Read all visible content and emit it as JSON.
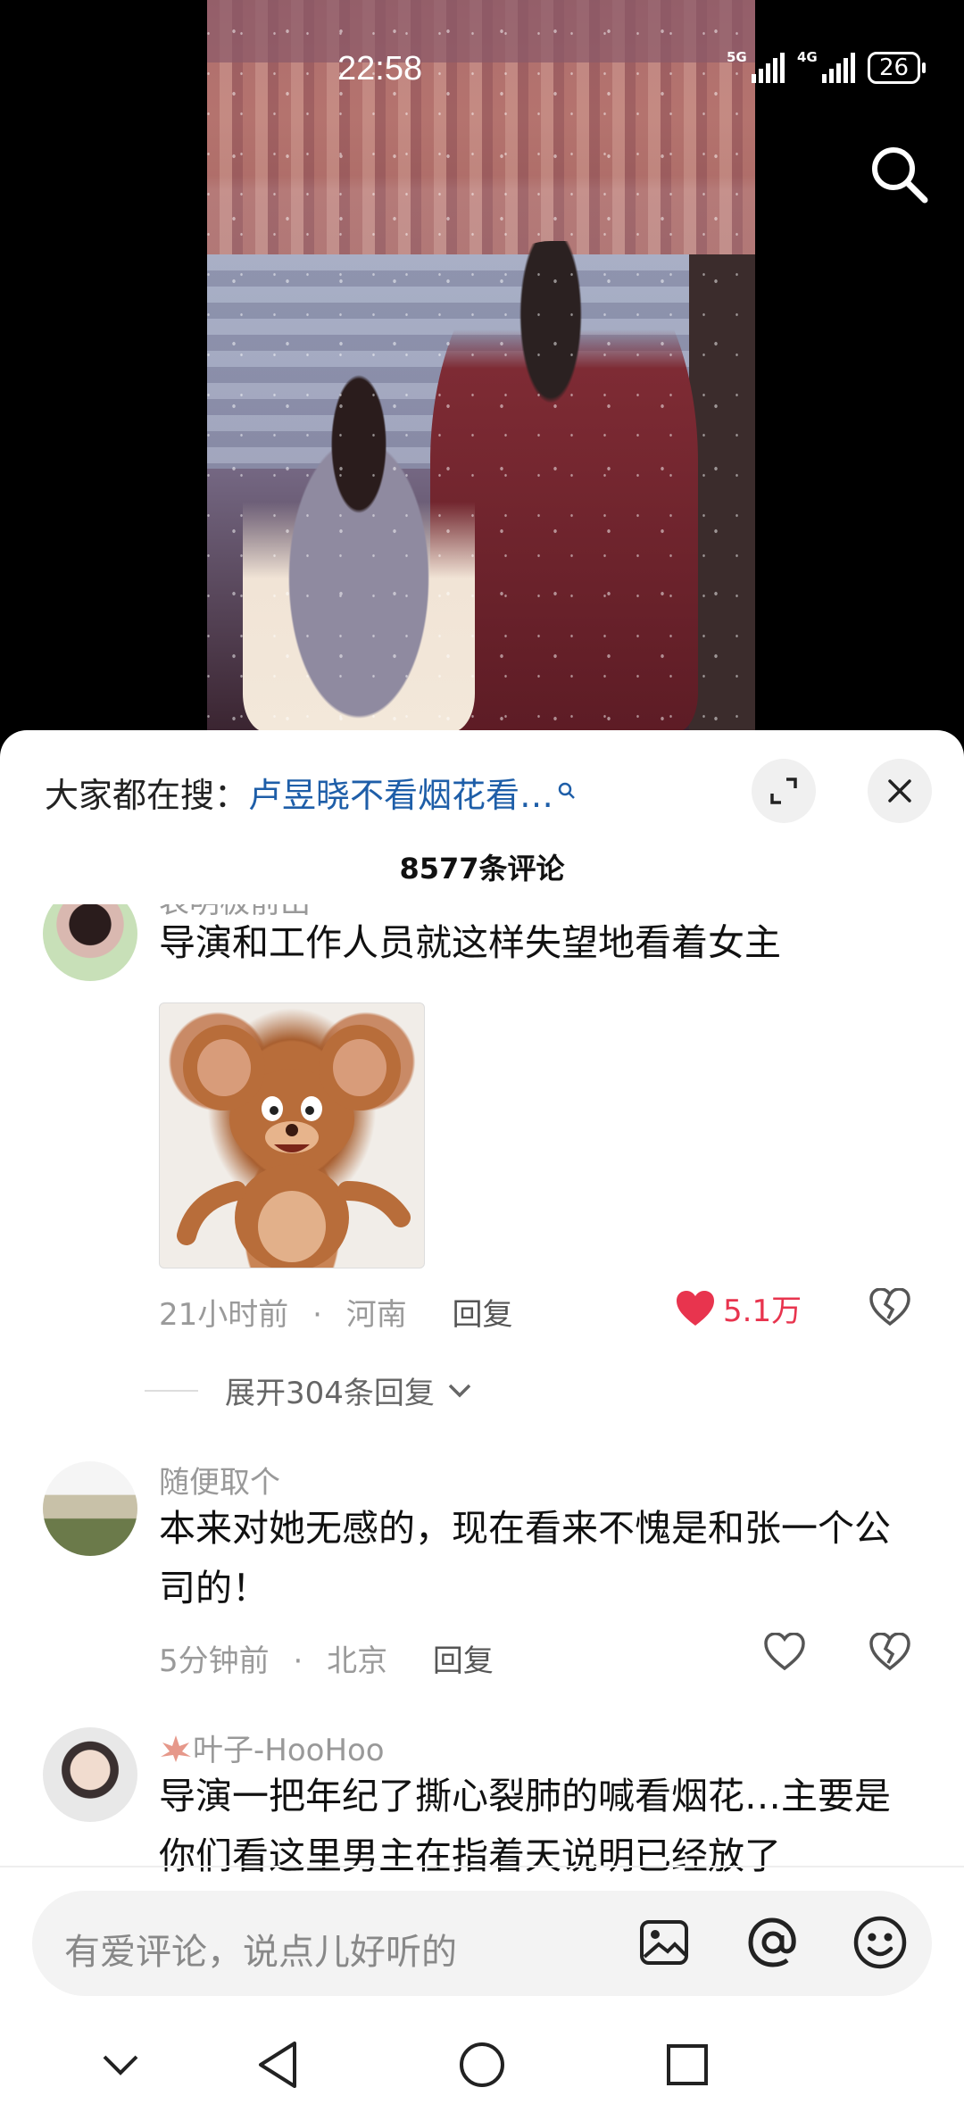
{
  "status_bar": {
    "time": "22:58",
    "signal1_label": "5G",
    "signal2_label": "4G",
    "battery": "26"
  },
  "video": {
    "search_icon": "search-icon"
  },
  "sheet": {
    "trending_prefix": "大家都在搜：",
    "trending_keyword": "卢昱晓不看烟花看…",
    "comment_count": "8577条评论",
    "expand_icon": "expand-icon",
    "close_icon": "close-icon"
  },
  "comments": [
    {
      "user": "表明极前出",
      "text": "导演和工作人员就这样失望地看着女主",
      "has_sticker": true,
      "time": "21小时前",
      "location": "河南",
      "reply_label": "回复",
      "likes": "5.1万",
      "liked": true,
      "expand_replies": "展开304条回复"
    },
    {
      "user": "随便取个",
      "text": "本来对她无感的，现在看来不愧是和张一个公司的！",
      "time": "5分钟前",
      "location": "北京",
      "reply_label": "回复",
      "liked": false
    },
    {
      "user": "叶子-HooHoo",
      "text": "导演一把年纪了撕心裂肺的喊看烟花…主要是你们看这里男主在指着天说明已经放了",
      "liked": false
    }
  ],
  "input_bar": {
    "placeholder": "有爱评论，说点儿好听的",
    "icons": [
      "image-icon",
      "at-icon",
      "emoji-icon"
    ]
  },
  "nav_bar": {
    "icons": [
      "chevron-down-icon",
      "back-icon",
      "home-icon",
      "recents-icon"
    ]
  },
  "colors": {
    "accent_link": "#1e5ea8",
    "like_red": "#e8344e",
    "sheet_bg": "#ffffff"
  }
}
